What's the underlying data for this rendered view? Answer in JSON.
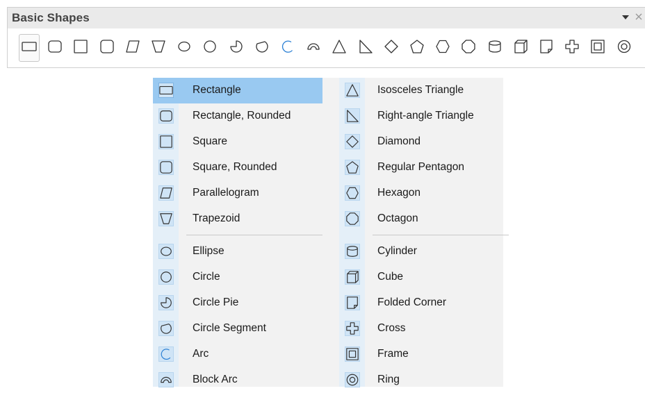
{
  "toolbar": {
    "title": "Basic Shapes",
    "dropdown_icon": "triangle-down-icon",
    "close_icon": "close-icon",
    "icons": [
      "rectangle",
      "rectangle-rounded",
      "square",
      "square-rounded",
      "parallelogram",
      "trapezoid",
      "ellipse",
      "circle",
      "circle-pie",
      "circle-segment",
      "arc",
      "block-arc",
      "isosceles-triangle",
      "right-triangle",
      "diamond",
      "pentagon",
      "hexagon",
      "octagon",
      "cylinder",
      "cube",
      "folded-corner",
      "cross",
      "frame",
      "ring"
    ],
    "selected_icon": "rectangle",
    "accent_color": "#2a7fd4"
  },
  "menu": {
    "selected_item": "Rectangle",
    "colors": {
      "selected_bg": "#99c9f1",
      "gutter_bg": "#e4eff8",
      "menu_bg": "#f2f2f2"
    },
    "left_column": [
      {
        "label": "Rectangle",
        "icon": "rectangle"
      },
      {
        "label": "Rectangle, Rounded",
        "icon": "rectangle-rounded"
      },
      {
        "label": "Square",
        "icon": "square"
      },
      {
        "label": "Square, Rounded",
        "icon": "square-rounded"
      },
      {
        "label": "Parallelogram",
        "icon": "parallelogram"
      },
      {
        "label": "Trapezoid",
        "icon": "trapezoid"
      },
      {
        "label": "Ellipse",
        "icon": "ellipse"
      },
      {
        "label": "Circle",
        "icon": "circle"
      },
      {
        "label": "Circle Pie",
        "icon": "circle-pie"
      },
      {
        "label": "Circle Segment",
        "icon": "circle-segment"
      },
      {
        "label": "Arc",
        "icon": "arc"
      },
      {
        "label": "Block Arc",
        "icon": "block-arc"
      }
    ],
    "right_column": [
      {
        "label": "Isosceles Triangle",
        "icon": "isosceles-triangle"
      },
      {
        "label": "Right-angle Triangle",
        "icon": "right-triangle"
      },
      {
        "label": "Diamond",
        "icon": "diamond"
      },
      {
        "label": "Regular Pentagon",
        "icon": "pentagon"
      },
      {
        "label": "Hexagon",
        "icon": "hexagon"
      },
      {
        "label": "Octagon",
        "icon": "octagon"
      },
      {
        "label": "Cylinder",
        "icon": "cylinder"
      },
      {
        "label": "Cube",
        "icon": "cube"
      },
      {
        "label": "Folded Corner",
        "icon": "folded-corner"
      },
      {
        "label": "Cross",
        "icon": "cross"
      },
      {
        "label": "Frame",
        "icon": "frame"
      },
      {
        "label": "Ring",
        "icon": "ring"
      }
    ]
  }
}
